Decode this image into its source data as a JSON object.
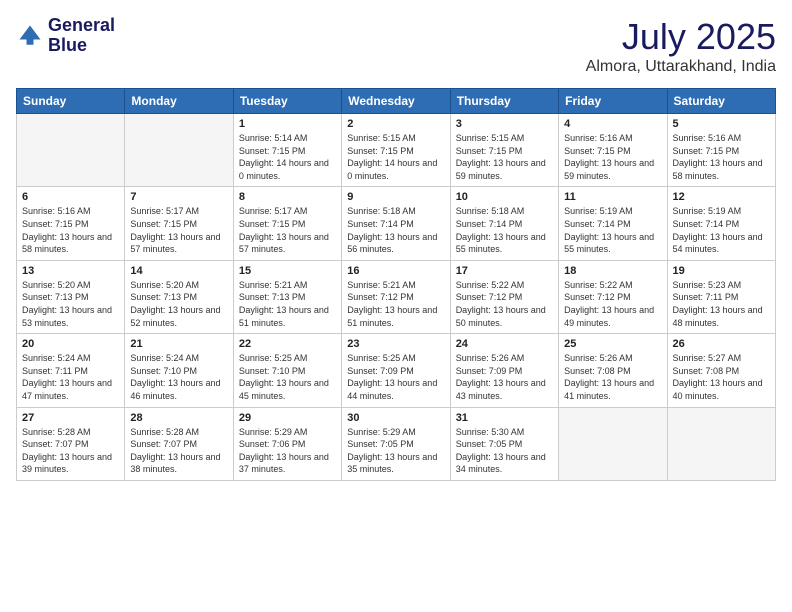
{
  "logo": {
    "line1": "General",
    "line2": "Blue"
  },
  "title": "July 2025",
  "subtitle": "Almora, Uttarakhand, India",
  "weekdays": [
    "Sunday",
    "Monday",
    "Tuesday",
    "Wednesday",
    "Thursday",
    "Friday",
    "Saturday"
  ],
  "weeks": [
    [
      {
        "day": null
      },
      {
        "day": null
      },
      {
        "day": "1",
        "sunrise": "Sunrise: 5:14 AM",
        "sunset": "Sunset: 7:15 PM",
        "daylight": "Daylight: 14 hours and 0 minutes."
      },
      {
        "day": "2",
        "sunrise": "Sunrise: 5:15 AM",
        "sunset": "Sunset: 7:15 PM",
        "daylight": "Daylight: 14 hours and 0 minutes."
      },
      {
        "day": "3",
        "sunrise": "Sunrise: 5:15 AM",
        "sunset": "Sunset: 7:15 PM",
        "daylight": "Daylight: 13 hours and 59 minutes."
      },
      {
        "day": "4",
        "sunrise": "Sunrise: 5:16 AM",
        "sunset": "Sunset: 7:15 PM",
        "daylight": "Daylight: 13 hours and 59 minutes."
      },
      {
        "day": "5",
        "sunrise": "Sunrise: 5:16 AM",
        "sunset": "Sunset: 7:15 PM",
        "daylight": "Daylight: 13 hours and 58 minutes."
      }
    ],
    [
      {
        "day": "6",
        "sunrise": "Sunrise: 5:16 AM",
        "sunset": "Sunset: 7:15 PM",
        "daylight": "Daylight: 13 hours and 58 minutes."
      },
      {
        "day": "7",
        "sunrise": "Sunrise: 5:17 AM",
        "sunset": "Sunset: 7:15 PM",
        "daylight": "Daylight: 13 hours and 57 minutes."
      },
      {
        "day": "8",
        "sunrise": "Sunrise: 5:17 AM",
        "sunset": "Sunset: 7:15 PM",
        "daylight": "Daylight: 13 hours and 57 minutes."
      },
      {
        "day": "9",
        "sunrise": "Sunrise: 5:18 AM",
        "sunset": "Sunset: 7:14 PM",
        "daylight": "Daylight: 13 hours and 56 minutes."
      },
      {
        "day": "10",
        "sunrise": "Sunrise: 5:18 AM",
        "sunset": "Sunset: 7:14 PM",
        "daylight": "Daylight: 13 hours and 55 minutes."
      },
      {
        "day": "11",
        "sunrise": "Sunrise: 5:19 AM",
        "sunset": "Sunset: 7:14 PM",
        "daylight": "Daylight: 13 hours and 55 minutes."
      },
      {
        "day": "12",
        "sunrise": "Sunrise: 5:19 AM",
        "sunset": "Sunset: 7:14 PM",
        "daylight": "Daylight: 13 hours and 54 minutes."
      }
    ],
    [
      {
        "day": "13",
        "sunrise": "Sunrise: 5:20 AM",
        "sunset": "Sunset: 7:13 PM",
        "daylight": "Daylight: 13 hours and 53 minutes."
      },
      {
        "day": "14",
        "sunrise": "Sunrise: 5:20 AM",
        "sunset": "Sunset: 7:13 PM",
        "daylight": "Daylight: 13 hours and 52 minutes."
      },
      {
        "day": "15",
        "sunrise": "Sunrise: 5:21 AM",
        "sunset": "Sunset: 7:13 PM",
        "daylight": "Daylight: 13 hours and 51 minutes."
      },
      {
        "day": "16",
        "sunrise": "Sunrise: 5:21 AM",
        "sunset": "Sunset: 7:12 PM",
        "daylight": "Daylight: 13 hours and 51 minutes."
      },
      {
        "day": "17",
        "sunrise": "Sunrise: 5:22 AM",
        "sunset": "Sunset: 7:12 PM",
        "daylight": "Daylight: 13 hours and 50 minutes."
      },
      {
        "day": "18",
        "sunrise": "Sunrise: 5:22 AM",
        "sunset": "Sunset: 7:12 PM",
        "daylight": "Daylight: 13 hours and 49 minutes."
      },
      {
        "day": "19",
        "sunrise": "Sunrise: 5:23 AM",
        "sunset": "Sunset: 7:11 PM",
        "daylight": "Daylight: 13 hours and 48 minutes."
      }
    ],
    [
      {
        "day": "20",
        "sunrise": "Sunrise: 5:24 AM",
        "sunset": "Sunset: 7:11 PM",
        "daylight": "Daylight: 13 hours and 47 minutes."
      },
      {
        "day": "21",
        "sunrise": "Sunrise: 5:24 AM",
        "sunset": "Sunset: 7:10 PM",
        "daylight": "Daylight: 13 hours and 46 minutes."
      },
      {
        "day": "22",
        "sunrise": "Sunrise: 5:25 AM",
        "sunset": "Sunset: 7:10 PM",
        "daylight": "Daylight: 13 hours and 45 minutes."
      },
      {
        "day": "23",
        "sunrise": "Sunrise: 5:25 AM",
        "sunset": "Sunset: 7:09 PM",
        "daylight": "Daylight: 13 hours and 44 minutes."
      },
      {
        "day": "24",
        "sunrise": "Sunrise: 5:26 AM",
        "sunset": "Sunset: 7:09 PM",
        "daylight": "Daylight: 13 hours and 43 minutes."
      },
      {
        "day": "25",
        "sunrise": "Sunrise: 5:26 AM",
        "sunset": "Sunset: 7:08 PM",
        "daylight": "Daylight: 13 hours and 41 minutes."
      },
      {
        "day": "26",
        "sunrise": "Sunrise: 5:27 AM",
        "sunset": "Sunset: 7:08 PM",
        "daylight": "Daylight: 13 hours and 40 minutes."
      }
    ],
    [
      {
        "day": "27",
        "sunrise": "Sunrise: 5:28 AM",
        "sunset": "Sunset: 7:07 PM",
        "daylight": "Daylight: 13 hours and 39 minutes."
      },
      {
        "day": "28",
        "sunrise": "Sunrise: 5:28 AM",
        "sunset": "Sunset: 7:07 PM",
        "daylight": "Daylight: 13 hours and 38 minutes."
      },
      {
        "day": "29",
        "sunrise": "Sunrise: 5:29 AM",
        "sunset": "Sunset: 7:06 PM",
        "daylight": "Daylight: 13 hours and 37 minutes."
      },
      {
        "day": "30",
        "sunrise": "Sunrise: 5:29 AM",
        "sunset": "Sunset: 7:05 PM",
        "daylight": "Daylight: 13 hours and 35 minutes."
      },
      {
        "day": "31",
        "sunrise": "Sunrise: 5:30 AM",
        "sunset": "Sunset: 7:05 PM",
        "daylight": "Daylight: 13 hours and 34 minutes."
      },
      {
        "day": null
      },
      {
        "day": null
      }
    ]
  ]
}
